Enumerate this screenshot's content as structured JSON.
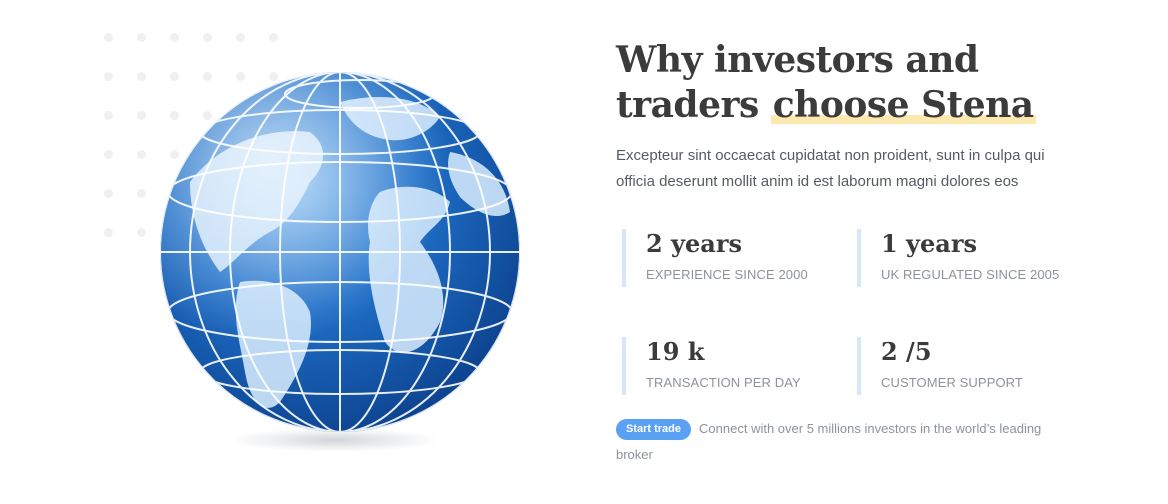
{
  "headline": {
    "line1": "Why investors and",
    "line2_pre": "traders ",
    "line2_highlight": "choose Stena"
  },
  "lead": "Excepteur sint occaecat cupidatat non proident, sunt in culpa qui officia deserunt mollit anim id est laborum magni dolores eos",
  "stats": [
    {
      "value": "2 years",
      "label": "EXPERIENCE SINCE 2000"
    },
    {
      "value": "1 years",
      "label": "UK REGULATED SINCE 2005"
    },
    {
      "value": "19 k",
      "label": "TRANSACTION PER DAY"
    },
    {
      "value": "2 /5",
      "label": "CUSTOMER SUPPORT"
    }
  ],
  "cta": {
    "button": "Start trade",
    "text": "Connect with over 5 millions investors in the world’s leading broker"
  },
  "colors": {
    "accent": "#5aa0f3",
    "highlight": "#fde9b0",
    "stat_border": "#d7e6f8",
    "globe_ocean": "#1f6fc8",
    "globe_land": "#cfe6fb"
  },
  "icons": [
    "globe-illustration",
    "dot-grid-decoration"
  ]
}
